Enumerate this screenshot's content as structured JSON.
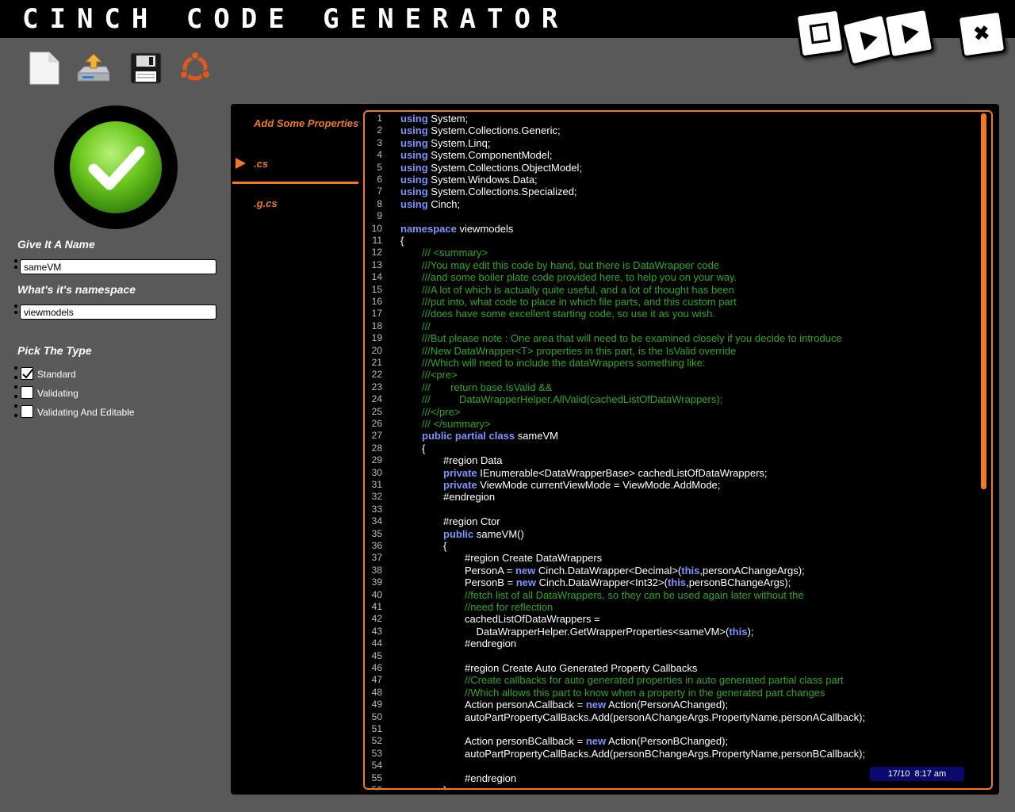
{
  "app": {
    "title": "CINCH CODE GENERATOR"
  },
  "window_buttons": [
    {
      "name": "stop-icon"
    },
    {
      "name": "play-icon"
    },
    {
      "name": "fast-forward-icon"
    },
    {
      "name": "close-icon",
      "glyph": "✖"
    }
  ],
  "toolbar": [
    {
      "name": "new-file-icon"
    },
    {
      "name": "open-file-icon"
    },
    {
      "name": "save-icon"
    },
    {
      "name": "ubuntu-icon"
    }
  ],
  "status": {
    "icon": "checkmark-icon",
    "color": "#5ec61a"
  },
  "form": {
    "name_label": "Give It A Name",
    "name_value": "sameVM",
    "namespace_label": "What's it's namespace",
    "namespace_value": "viewmodels",
    "type_label": "Pick The Type",
    "types": [
      {
        "label": "Standard",
        "checked": true
      },
      {
        "label": "Validating",
        "checked": false
      },
      {
        "label": "Validating And Editable",
        "checked": false
      }
    ]
  },
  "tabs": [
    {
      "label": "Add Some Properties"
    },
    {
      "label": ".cs",
      "selected": true
    },
    {
      "label": ".g.cs"
    }
  ],
  "clock": {
    "date": "17/10",
    "time": "8:17 am"
  },
  "colors": {
    "accent": "#f07a1c",
    "keyword": "#7b95ff",
    "comment": "#2ea822"
  },
  "code_lines": [
    [
      [
        "k",
        "using"
      ],
      [
        "t",
        " System;"
      ]
    ],
    [
      [
        "k",
        "using"
      ],
      [
        "t",
        " System.Collections.Generic;"
      ]
    ],
    [
      [
        "k",
        "using"
      ],
      [
        "t",
        " System.Linq;"
      ]
    ],
    [
      [
        "k",
        "using"
      ],
      [
        "t",
        " System.ComponentModel;"
      ]
    ],
    [
      [
        "k",
        "using"
      ],
      [
        "t",
        " System.Collections.ObjectModel;"
      ]
    ],
    [
      [
        "k",
        "using"
      ],
      [
        "t",
        " System.Windows.Data;"
      ]
    ],
    [
      [
        "k",
        "using"
      ],
      [
        "t",
        " System.Collections.Specialized;"
      ]
    ],
    [
      [
        "k",
        "using"
      ],
      [
        "t",
        " Cinch;"
      ]
    ],
    [],
    [
      [
        "k",
        "namespace"
      ],
      [
        "t",
        " viewmodels"
      ]
    ],
    [
      [
        "t",
        "{"
      ]
    ],
    [
      [
        "t",
        "\t"
      ],
      [
        "c",
        "/// <summary>"
      ]
    ],
    [
      [
        "t",
        "\t"
      ],
      [
        "c",
        "///You may edit this code by hand, but there is DataWrapper code"
      ]
    ],
    [
      [
        "t",
        "\t"
      ],
      [
        "c",
        "///and some boiler plate code provided here, to help you on your way."
      ]
    ],
    [
      [
        "t",
        "\t"
      ],
      [
        "c",
        "///A lot of which is actually quite useful, and a lot of thought has been"
      ]
    ],
    [
      [
        "t",
        "\t"
      ],
      [
        "c",
        "///put into, what code to place in which file parts, and this custom part"
      ]
    ],
    [
      [
        "t",
        "\t"
      ],
      [
        "c",
        "///does have some excellent starting code, so use it as you wish."
      ]
    ],
    [
      [
        "t",
        "\t"
      ],
      [
        "c",
        "///"
      ]
    ],
    [
      [
        "t",
        "\t"
      ],
      [
        "c",
        "///But please note : One area that will need to be examined closely if you decide to introduce"
      ]
    ],
    [
      [
        "t",
        "\t"
      ],
      [
        "c",
        "///New DataWrapper<T> properties in this part, is the IsValid override"
      ]
    ],
    [
      [
        "t",
        "\t"
      ],
      [
        "c",
        "///Which will need to include the dataWrappers something like:"
      ]
    ],
    [
      [
        "t",
        "\t"
      ],
      [
        "c",
        "///<pre>"
      ]
    ],
    [
      [
        "t",
        "\t"
      ],
      [
        "c",
        "///       return base.IsValid &&"
      ]
    ],
    [
      [
        "t",
        "\t"
      ],
      [
        "c",
        "///          DataWrapperHelper.AllValid(cachedListOfDataWrappers);"
      ]
    ],
    [
      [
        "t",
        "\t"
      ],
      [
        "c",
        "///</pre>"
      ]
    ],
    [
      [
        "t",
        "\t"
      ],
      [
        "c",
        "/// </summary>"
      ]
    ],
    [
      [
        "t",
        "\t"
      ],
      [
        "k",
        "public"
      ],
      [
        "t",
        " "
      ],
      [
        "k",
        "partial"
      ],
      [
        "t",
        " "
      ],
      [
        "k",
        "class"
      ],
      [
        "t",
        " sameVM"
      ]
    ],
    [
      [
        "t",
        "\t{"
      ]
    ],
    [
      [
        "t",
        "\t\t#region Data"
      ]
    ],
    [
      [
        "t",
        "\t\t"
      ],
      [
        "k",
        "private"
      ],
      [
        "t",
        " IEnumerable<DataWrapperBase> cachedListOfDataWrappers;"
      ]
    ],
    [
      [
        "t",
        "\t\t"
      ],
      [
        "k",
        "private"
      ],
      [
        "t",
        " ViewMode currentViewMode = ViewMode.AddMode;"
      ]
    ],
    [
      [
        "t",
        "\t\t#endregion"
      ]
    ],
    [],
    [
      [
        "t",
        "\t\t#region Ctor"
      ]
    ],
    [
      [
        "t",
        "\t\t"
      ],
      [
        "k",
        "public"
      ],
      [
        "t",
        " sameVM()"
      ]
    ],
    [
      [
        "t",
        "\t\t{"
      ]
    ],
    [
      [
        "t",
        "\t\t\t#region Create DataWrappers"
      ]
    ],
    [
      [
        "t",
        "\t\t\tPersonA = "
      ],
      [
        "k",
        "new"
      ],
      [
        "t",
        " Cinch.DataWrapper<Decimal>("
      ],
      [
        "k",
        "this"
      ],
      [
        "t",
        ",personAChangeArgs);"
      ]
    ],
    [
      [
        "t",
        "\t\t\tPersonB = "
      ],
      [
        "k",
        "new"
      ],
      [
        "t",
        " Cinch.DataWrapper<Int32>("
      ],
      [
        "k",
        "this"
      ],
      [
        "t",
        ",personBChangeArgs);"
      ]
    ],
    [
      [
        "t",
        "\t\t\t"
      ],
      [
        "c",
        "//fetch list of all DataWrappers, so they can be used again later without the"
      ]
    ],
    [
      [
        "t",
        "\t\t\t"
      ],
      [
        "c",
        "//need for reflection"
      ]
    ],
    [
      [
        "t",
        "\t\t\tcachedListOfDataWrappers ="
      ]
    ],
    [
      [
        "t",
        "\t\t\t    DataWrapperHelper.GetWrapperProperties<sameVM>("
      ],
      [
        "k",
        "this"
      ],
      [
        "t",
        ");"
      ]
    ],
    [
      [
        "t",
        "\t\t\t#endregion"
      ]
    ],
    [],
    [
      [
        "t",
        "\t\t\t#region Create Auto Generated Property Callbacks"
      ]
    ],
    [
      [
        "t",
        "\t\t\t"
      ],
      [
        "c",
        "//Create callbacks for auto generated properties in auto generated partial class part"
      ]
    ],
    [
      [
        "t",
        "\t\t\t"
      ],
      [
        "c",
        "//Which allows this part to know when a property in the generated part changes"
      ]
    ],
    [
      [
        "t",
        "\t\t\tAction personACallback = "
      ],
      [
        "k",
        "new"
      ],
      [
        "t",
        " Action(PersonAChanged);"
      ]
    ],
    [
      [
        "t",
        "\t\t\tautoPartPropertyCallBacks.Add(personAChangeArgs.PropertyName,personACallback);"
      ]
    ],
    [],
    [
      [
        "t",
        "\t\t\tAction personBCallback = "
      ],
      [
        "k",
        "new"
      ],
      [
        "t",
        " Action(PersonBChanged);"
      ]
    ],
    [
      [
        "t",
        "\t\t\tautoPartPropertyCallBacks.Add(personBChangeArgs.PropertyName,personBCallback);"
      ]
    ],
    [],
    [
      [
        "t",
        "\t\t\t#endregion"
      ]
    ],
    [
      [
        "t",
        "\t\t}"
      ]
    ]
  ]
}
